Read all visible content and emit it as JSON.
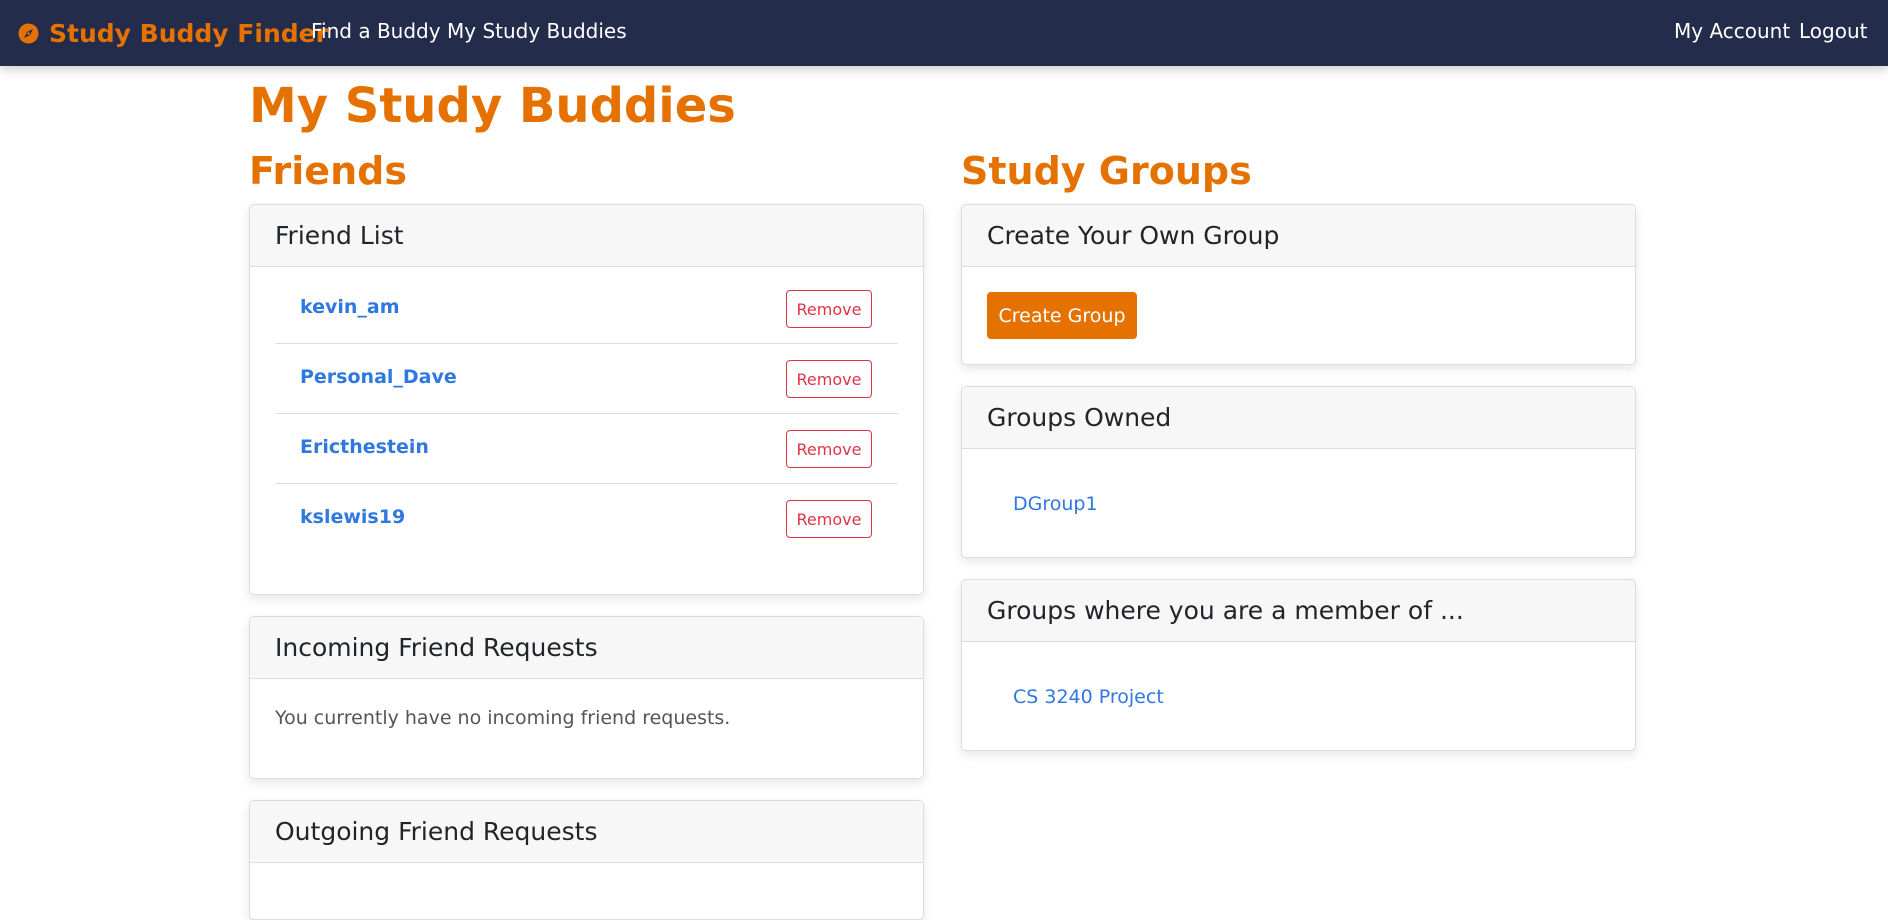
{
  "navbar": {
    "brand": "Study Buddy Finder",
    "brand_icon": "compass-icon",
    "links": [
      "Find a Buddy",
      "My Study Buddies"
    ],
    "right_links": [
      "My Account",
      "Logout"
    ],
    "colors": {
      "background": "#232d4b",
      "accent": "#e57200"
    }
  },
  "page": {
    "title": "My Study Buddies"
  },
  "friends": {
    "section_title": "Friends",
    "friend_list": {
      "title": "Friend List",
      "items": [
        {
          "name": "kevin_am",
          "action": "Remove"
        },
        {
          "name": "Personal_Dave",
          "action": "Remove"
        },
        {
          "name": "Ericthestein",
          "action": "Remove"
        },
        {
          "name": "kslewis19",
          "action": "Remove"
        }
      ]
    },
    "incoming": {
      "title": "Incoming Friend Requests",
      "empty_text": "You currently have no incoming friend requests."
    },
    "outgoing": {
      "title": "Outgoing Friend Requests"
    }
  },
  "groups": {
    "section_title": "Study Groups",
    "create": {
      "title": "Create Your Own Group",
      "button": "Create Group"
    },
    "owned": {
      "title": "Groups Owned",
      "items": [
        "DGroup1"
      ]
    },
    "member": {
      "title": "Groups where you are a member of ...",
      "items": [
        "CS 3240 Project"
      ]
    }
  }
}
